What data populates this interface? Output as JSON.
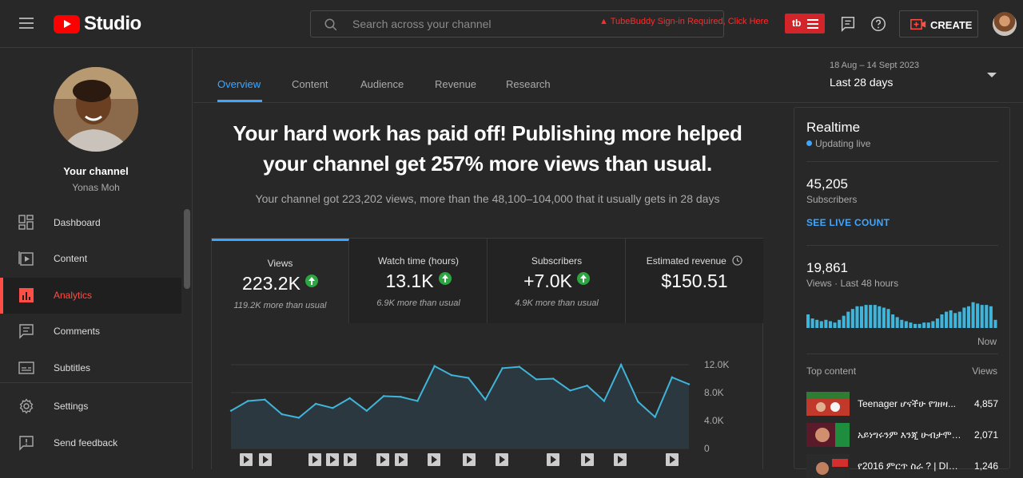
{
  "app": {
    "title": "Studio"
  },
  "search": {
    "placeholder": "Search across your channel"
  },
  "tubebuddy": {
    "warning": "TubeBuddy Sign-in Required, Click Here",
    "badge": "tb"
  },
  "header": {
    "create_label": "CREATE"
  },
  "channel": {
    "title": "Your channel",
    "name": "Yonas Moh"
  },
  "sidebar": {
    "items": [
      {
        "label": "Dashboard",
        "icon": "dashboard-icon"
      },
      {
        "label": "Content",
        "icon": "content-icon"
      },
      {
        "label": "Analytics",
        "icon": "analytics-icon",
        "active": true
      },
      {
        "label": "Comments",
        "icon": "comments-icon"
      },
      {
        "label": "Subtitles",
        "icon": "subtitles-icon"
      },
      {
        "label": "Settings",
        "icon": "gear-icon"
      },
      {
        "label": "Send feedback",
        "icon": "feedback-icon"
      }
    ]
  },
  "tabs": [
    {
      "label": "Overview",
      "active": true
    },
    {
      "label": "Content"
    },
    {
      "label": "Audience"
    },
    {
      "label": "Revenue"
    },
    {
      "label": "Research"
    }
  ],
  "date": {
    "range": "18 Aug – 14 Sept 2023",
    "label": "Last 28 days"
  },
  "headline": "Your hard work has paid off! Publishing more helped your channel get 257% more views than usual.",
  "subline": "Your channel got 223,202 views, more than the 48,100–104,000 that it usually gets in 28 days",
  "metrics": [
    {
      "label": "Views",
      "value": "223.2K",
      "sub": "119.2K more than usual",
      "up": true
    },
    {
      "label": "Watch time (hours)",
      "value": "13.1K",
      "sub": "6.9K more than usual",
      "up": true
    },
    {
      "label": "Subscribers",
      "value": "+7.0K",
      "sub": "4.9K more than usual",
      "up": true
    },
    {
      "label": "Estimated revenue",
      "value": "$150.51",
      "sub": ""
    }
  ],
  "chart_data": {
    "type": "area",
    "y_ticks": [
      "12.0K",
      "8.0K",
      "4.0K",
      "0"
    ],
    "ylim": [
      0,
      12000
    ],
    "values": [
      5400,
      6800,
      7000,
      4900,
      4400,
      6400,
      5800,
      7200,
      5400,
      7500,
      7400,
      6800,
      11800,
      10500,
      10100,
      7000,
      11500,
      11700,
      9900,
      10000,
      8300,
      9000,
      6800,
      12000,
      6700,
      4500,
      10200,
      9200
    ],
    "color": "#41b4d9"
  },
  "realtime": {
    "title": "Realtime",
    "status": "Updating live",
    "subscribers": "45,205",
    "subscribers_label": "Subscribers",
    "live_count_link": "SEE LIVE COUNT",
    "views": "19,861",
    "views_label": "Views · Last 48 hours",
    "now_label": "Now",
    "bars": [
      0.5,
      0.35,
      0.3,
      0.25,
      0.3,
      0.25,
      0.2,
      0.3,
      0.45,
      0.6,
      0.7,
      0.8,
      0.8,
      0.85,
      0.85,
      0.85,
      0.8,
      0.75,
      0.7,
      0.5,
      0.4,
      0.3,
      0.25,
      0.2,
      0.15,
      0.15,
      0.2,
      0.2,
      0.25,
      0.35,
      0.5,
      0.6,
      0.65,
      0.55,
      0.6,
      0.75,
      0.8,
      0.95,
      0.9,
      0.85,
      0.85,
      0.8,
      0.3
    ],
    "top_content_label": "Top content",
    "views_col_label": "Views",
    "top_content": [
      {
        "title": "Teenager ሆናችሁ የገዘዛ...",
        "views": "4,857"
      },
      {
        "title": "አይነግሩንም እንጂ ሁብታሞች...",
        "views": "2,071"
      },
      {
        "title": "የ2016 ምርጥ ስራ ? | DIG...",
        "views": "1,246"
      }
    ]
  }
}
